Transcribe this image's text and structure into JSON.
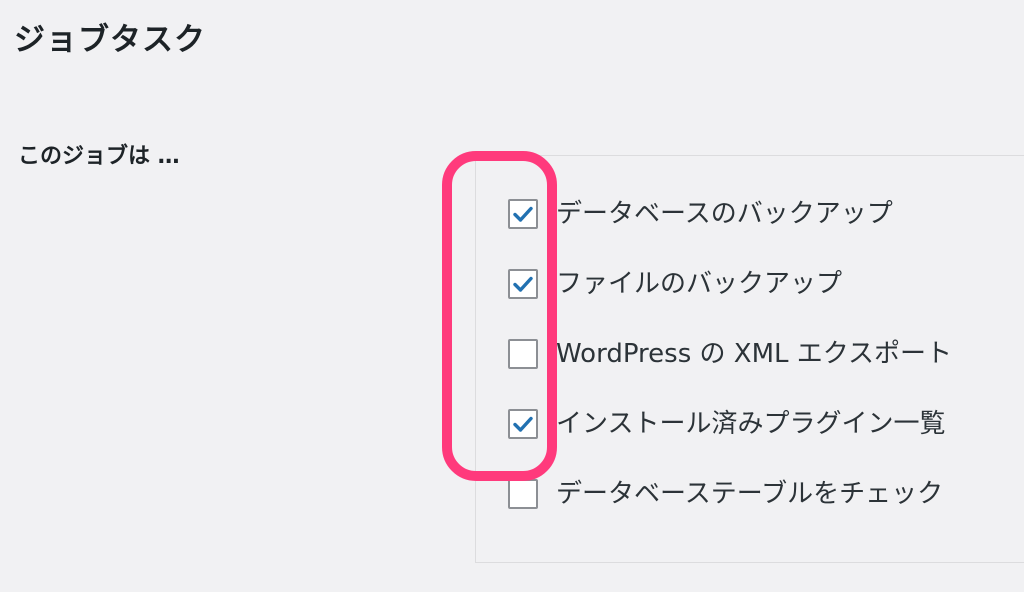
{
  "page": {
    "title": "ジョブタスク",
    "field_label": "このジョブは …"
  },
  "tasks": [
    {
      "label": "データベースのバックアップ",
      "checked": true
    },
    {
      "label": "ファイルのバックアップ",
      "checked": true
    },
    {
      "label": "WordPress の XML エクスポート",
      "checked": false
    },
    {
      "label": "インストール済みプラグイン一覧",
      "checked": true
    },
    {
      "label": "データベーステーブルをチェック",
      "checked": false
    }
  ],
  "colors": {
    "checkmark": "#2271b1",
    "highlight": "#ff3a7c",
    "background": "#f1f1f3"
  }
}
